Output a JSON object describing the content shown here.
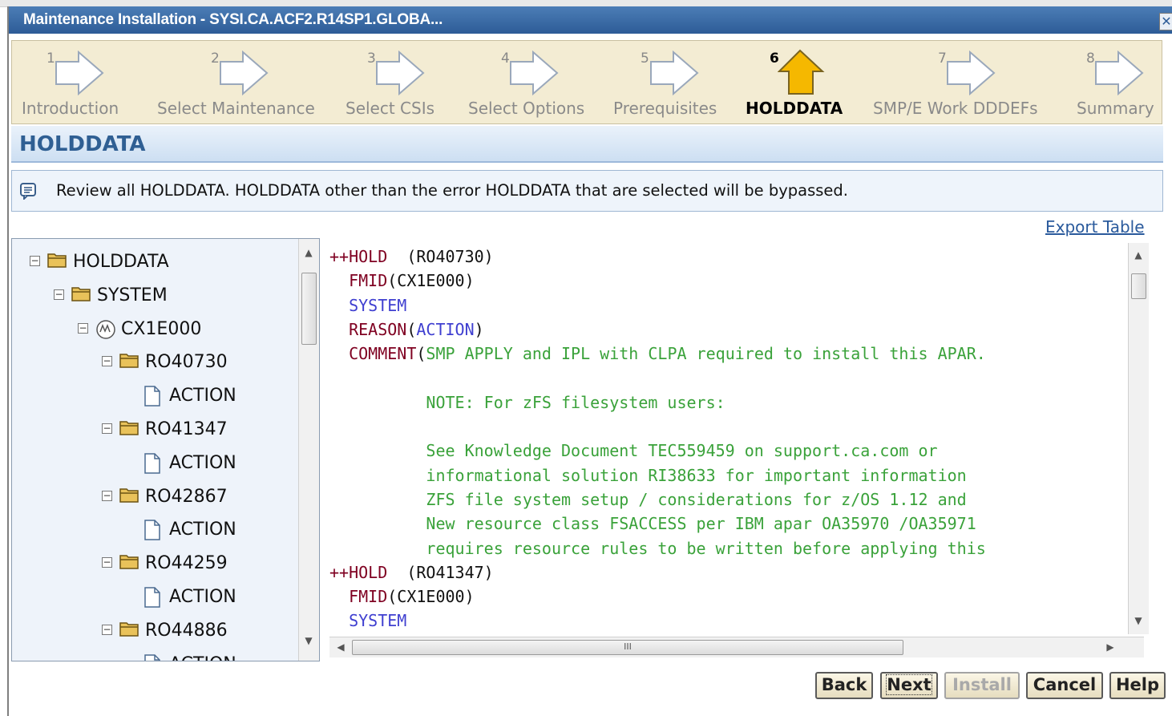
{
  "window": {
    "title": "Maintenance Installation - SYSI.CA.ACF2.R14SP1.GLOBA...",
    "close_glyph": "✕"
  },
  "wizard": {
    "steps": [
      {
        "num": "1",
        "label": "Introduction",
        "active": false
      },
      {
        "num": "2",
        "label": "Select Maintenance",
        "active": false
      },
      {
        "num": "3",
        "label": "Select CSIs",
        "active": false
      },
      {
        "num": "4",
        "label": "Select Options",
        "active": false
      },
      {
        "num": "5",
        "label": "Prerequisites",
        "active": false
      },
      {
        "num": "6",
        "label": "HOLDDATA",
        "active": true
      },
      {
        "num": "7",
        "label": "SMP/E Work DDDEFs",
        "active": false
      },
      {
        "num": "8",
        "label": "Summary",
        "active": false
      }
    ]
  },
  "section": {
    "title": "HOLDDATA"
  },
  "info": {
    "message": "Review all HOLDDATA. HOLDDATA other than the error HOLDDATA that are selected will be bypassed."
  },
  "export_link": "Export Table",
  "tree": {
    "nodes": [
      {
        "label": "HOLDDATA",
        "icon": "folder-icon",
        "toggle": "⊟"
      },
      {
        "label": "SYSTEM",
        "icon": "folder-icon",
        "toggle": "⊟"
      },
      {
        "label": "CX1E000",
        "icon": "fmid-icon",
        "toggle": "⊟"
      },
      {
        "label": "RO40730",
        "icon": "folder-icon",
        "toggle": "⊟"
      },
      {
        "label": "ACTION",
        "icon": "document-icon",
        "toggle": ""
      },
      {
        "label": "RO41347",
        "icon": "folder-icon",
        "toggle": "⊟"
      },
      {
        "label": "ACTION",
        "icon": "document-icon",
        "toggle": ""
      },
      {
        "label": "RO42867",
        "icon": "folder-icon",
        "toggle": "⊟"
      },
      {
        "label": "ACTION",
        "icon": "document-icon",
        "toggle": ""
      },
      {
        "label": "RO44259",
        "icon": "folder-icon",
        "toggle": "⊟"
      },
      {
        "label": "ACTION",
        "icon": "document-icon",
        "toggle": ""
      },
      {
        "label": "RO44886",
        "icon": "folder-icon",
        "toggle": "⊟"
      },
      {
        "label": "ACTION",
        "icon": "document-icon",
        "toggle": ""
      }
    ]
  },
  "holddata_text": {
    "lines": [
      [
        {
          "t": "++HOLD ",
          "c": "kw"
        },
        {
          "t": " (RO40730)",
          "c": "pl"
        }
      ],
      [
        {
          "t": "  FMID",
          "c": "kw"
        },
        {
          "t": "(CX1E000)",
          "c": "pl"
        }
      ],
      [
        {
          "t": "  SYSTEM",
          "c": "sy"
        }
      ],
      [
        {
          "t": "  REASON",
          "c": "kw"
        },
        {
          "t": "(",
          "c": "pl"
        },
        {
          "t": "ACTION",
          "c": "sy"
        },
        {
          "t": ")",
          "c": "pl"
        }
      ],
      [
        {
          "t": "  COMMENT",
          "c": "kw"
        },
        {
          "t": "(",
          "c": "pl"
        },
        {
          "t": "SMP APPLY and IPL with CLPA required to install this APAR.",
          "c": "cm"
        }
      ],
      [
        {
          "t": "",
          "c": "cm"
        }
      ],
      [
        {
          "t": "          NOTE: For zFS filesystem users:",
          "c": "cm"
        }
      ],
      [
        {
          "t": "",
          "c": "cm"
        }
      ],
      [
        {
          "t": "          See Knowledge Document TEC559459 on support.ca.com or",
          "c": "cm"
        }
      ],
      [
        {
          "t": "          informational solution RI38633 for important information",
          "c": "cm"
        }
      ],
      [
        {
          "t": "          ZFS file system setup / considerations for z/OS 1.12 and",
          "c": "cm"
        }
      ],
      [
        {
          "t": "          New resource class FSACCESS per IBM apar OA35970 /OA35971",
          "c": "cm"
        }
      ],
      [
        {
          "t": "          requires resource rules to be written before applying this",
          "c": "cm"
        }
      ],
      [
        {
          "t": "++HOLD ",
          "c": "kw"
        },
        {
          "t": " (RO41347)",
          "c": "pl"
        }
      ],
      [
        {
          "t": "  FMID",
          "c": "kw"
        },
        {
          "t": "(CX1E000)",
          "c": "pl"
        }
      ],
      [
        {
          "t": "  SYSTEM",
          "c": "sy"
        }
      ]
    ]
  },
  "scrollbar": {
    "h_thumb_grip": "III"
  },
  "buttons": {
    "back": "Back",
    "next": "Next",
    "install": "Install",
    "cancel": "Cancel",
    "help": "Help"
  },
  "colors": {
    "accent_active_step": "#f5b800",
    "title_bar": "#2d5c97",
    "keyword": "#7f0021",
    "system_keyword": "#3f3fd0",
    "comment": "#3aa23a"
  }
}
